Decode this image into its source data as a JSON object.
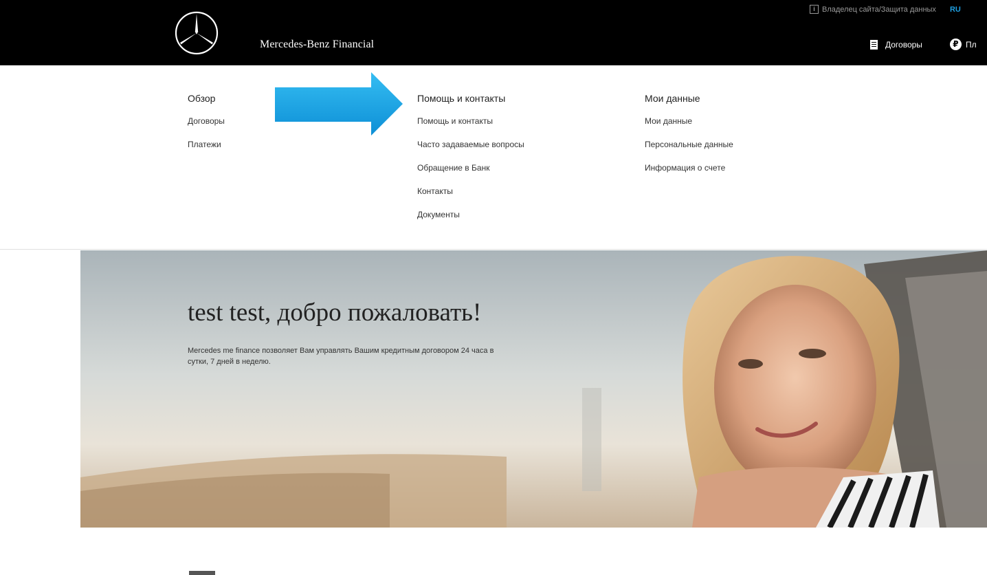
{
  "brand": {
    "name": "Mercedes-Benz Financial",
    "logo_icon": "mercedes-star-icon"
  },
  "utility": {
    "site_owner_link": "Владелец сайта/Защита данных",
    "language": "RU",
    "info_icon": "info-icon"
  },
  "main_nav": {
    "contracts": "Договоры",
    "payments": "Пл"
  },
  "menu": {
    "overview": {
      "heading": "Обзор",
      "links": [
        "Договоры",
        "Платежи"
      ]
    },
    "help": {
      "heading": "Помощь и контакты",
      "links": [
        "Помощь и контакты",
        "Часто задаваемые вопросы",
        "Обращение в Банк",
        "Контакты",
        "Документы"
      ]
    },
    "my_data": {
      "heading": "Мои данные",
      "links": [
        "Мои данные",
        "Персональные данные",
        "Информация о счете"
      ]
    }
  },
  "hero": {
    "title": "test test, добро пожаловать!",
    "text": "Mercedes me finance позволяет Вам управлять Вашим кредитным договором 24 часа в сутки, 7 дней в неделю."
  },
  "colors": {
    "topbar": "#000000",
    "accent_blue": "#1e9ee0",
    "arrow": "#1aa3e8"
  }
}
